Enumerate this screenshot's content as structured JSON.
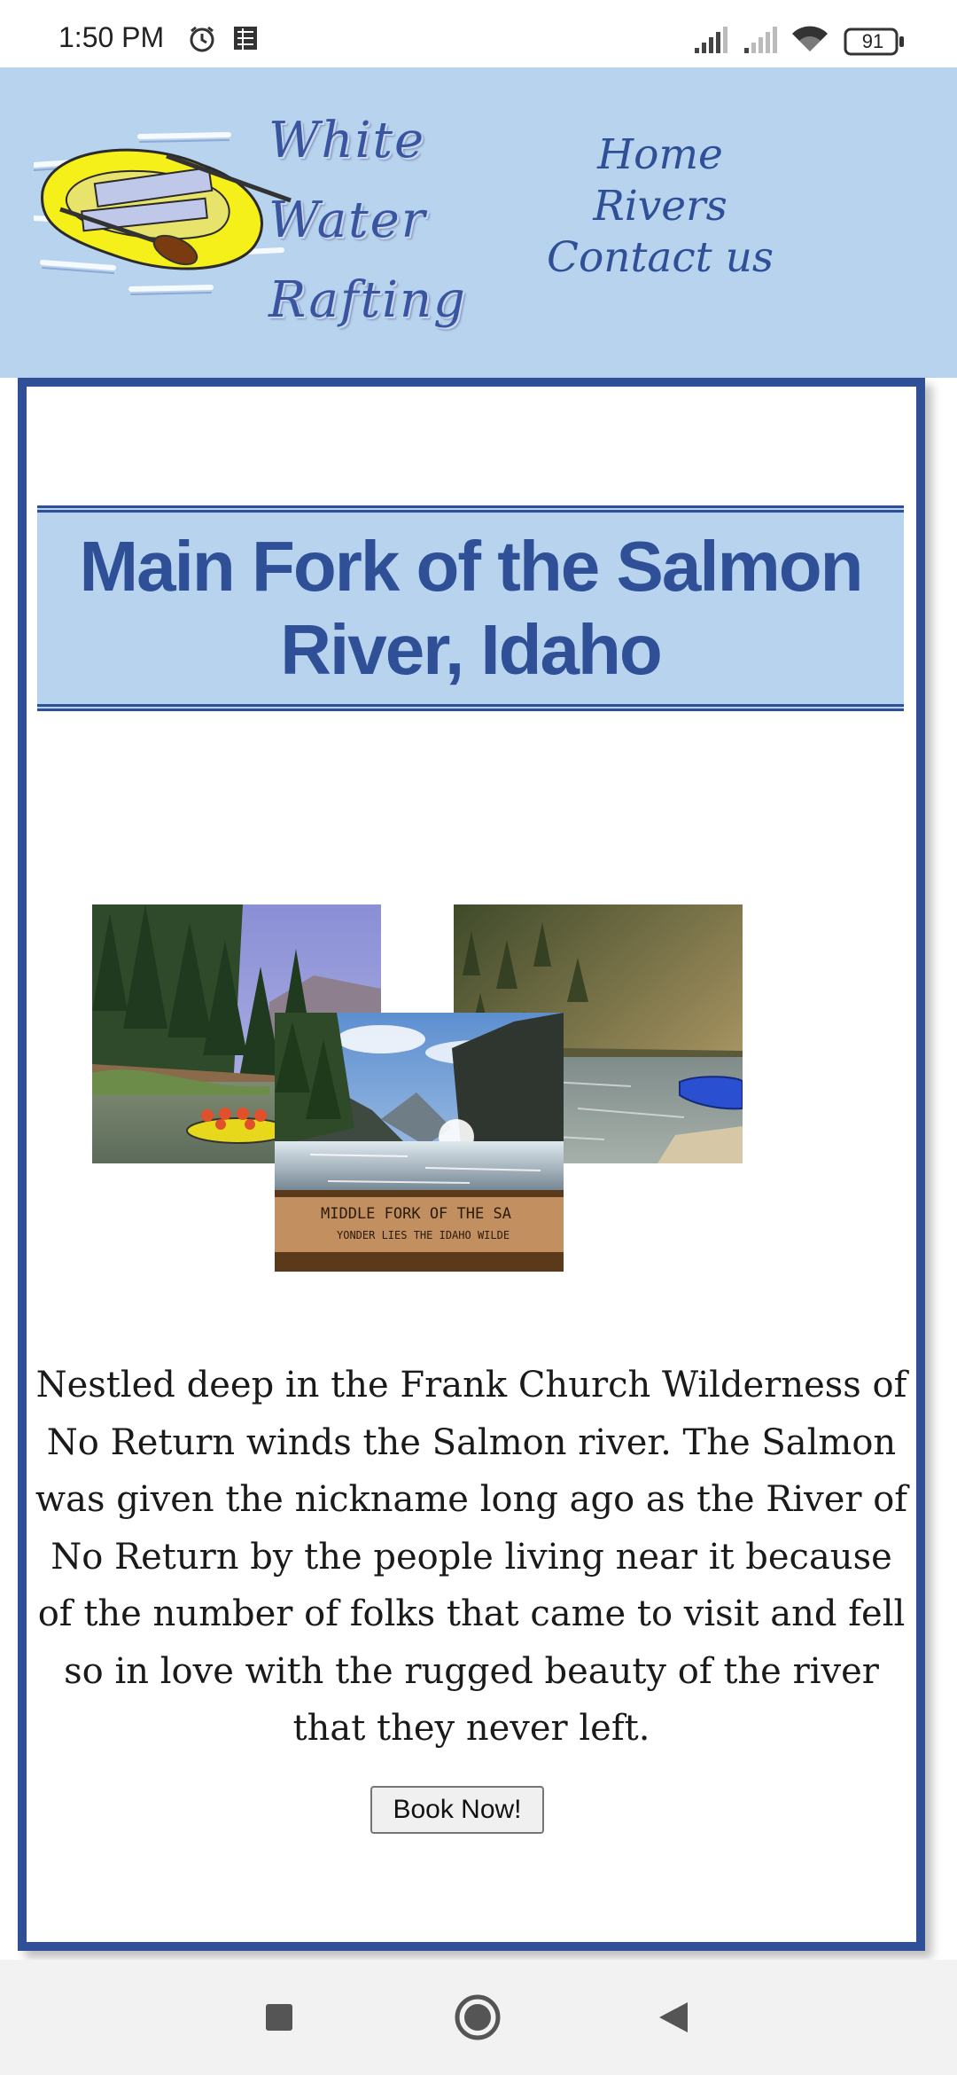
{
  "status_bar": {
    "time": "1:50 PM",
    "battery": "91",
    "icons": [
      "alarm-icon",
      "app-icon",
      "signal-icon",
      "signal-icon",
      "wifi-icon",
      "battery-icon"
    ]
  },
  "header": {
    "logo_words": [
      "White",
      "Water",
      "Rafting"
    ],
    "nav": {
      "home": "Home",
      "rivers": "Rivers",
      "contact": "Contact us"
    }
  },
  "main": {
    "title": "Main Fork of the Salmon River, Idaho",
    "description": "Nestled deep in the Frank Church Wilderness of No Return winds the Salmon river. The Salmon was given the nickname long ago as the River of No Return by the people living near it because of the number of folks that came to visit and fell so in love with the rugged beauty of the river that they never left.",
    "sign_line1": "MIDDLE FORK OF THE SA",
    "sign_line2": "YONDER LIES THE IDAHO WILDE",
    "button": "Book Now!"
  },
  "colors": {
    "header_bg": "#b7d3ee",
    "accent": "#2f4f96",
    "raft_yellow": "#f5ef1a"
  },
  "system_nav": [
    "recents-icon",
    "home-icon",
    "back-icon"
  ]
}
